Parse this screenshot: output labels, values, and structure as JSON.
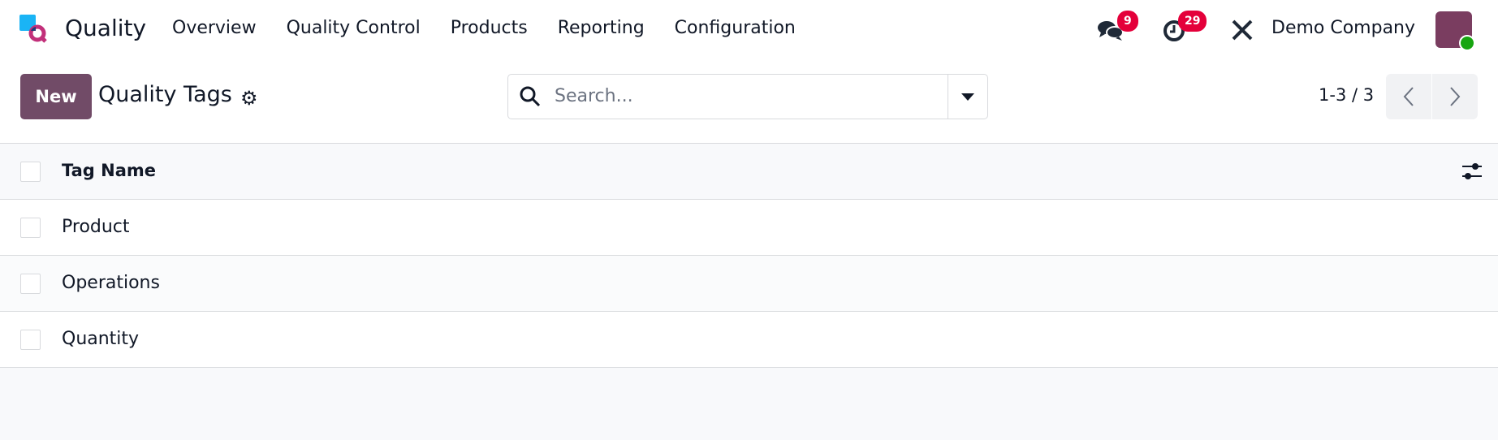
{
  "navbar": {
    "app_name": "Quality",
    "menu": [
      "Overview",
      "Quality Control",
      "Products",
      "Reporting",
      "Configuration"
    ],
    "messages_count": "9",
    "activities_count": "29",
    "company": "Demo Company"
  },
  "control_panel": {
    "new_label": "New",
    "title": "Quality Tags",
    "search_placeholder": "Search...",
    "pager": "1-3 / 3"
  },
  "table": {
    "header": "Tag Name",
    "rows": [
      "Product",
      "Operations",
      "Quantity"
    ]
  },
  "colors": {
    "primary": "#714b67",
    "badge": "#e4003a",
    "online": "#17a510"
  }
}
